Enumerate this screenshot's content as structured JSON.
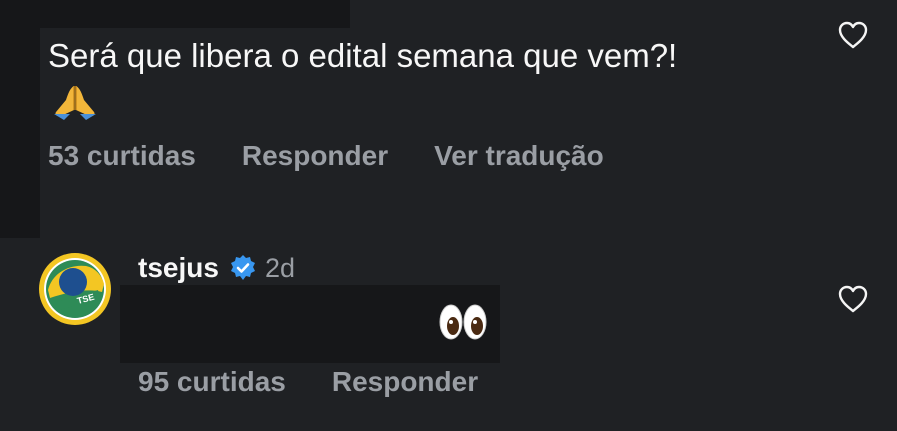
{
  "comment": {
    "text": "Será que libera o edital semana que vem?!",
    "emoji": "folded-hands",
    "likes_label": "53 curtidas",
    "reply_label": "Responder",
    "translate_label": "Ver tradução"
  },
  "reply": {
    "username": "tsejus",
    "verified": true,
    "time": "2d",
    "emoji": "eyes",
    "likes_label": "95 curtidas",
    "reply_label": "Responder",
    "avatar_text": "TSE"
  },
  "colors": {
    "background": "#1f2124",
    "text_primary": "#f7f7f7",
    "text_secondary": "#9a9ea4",
    "verified_blue": "#3897f0"
  }
}
